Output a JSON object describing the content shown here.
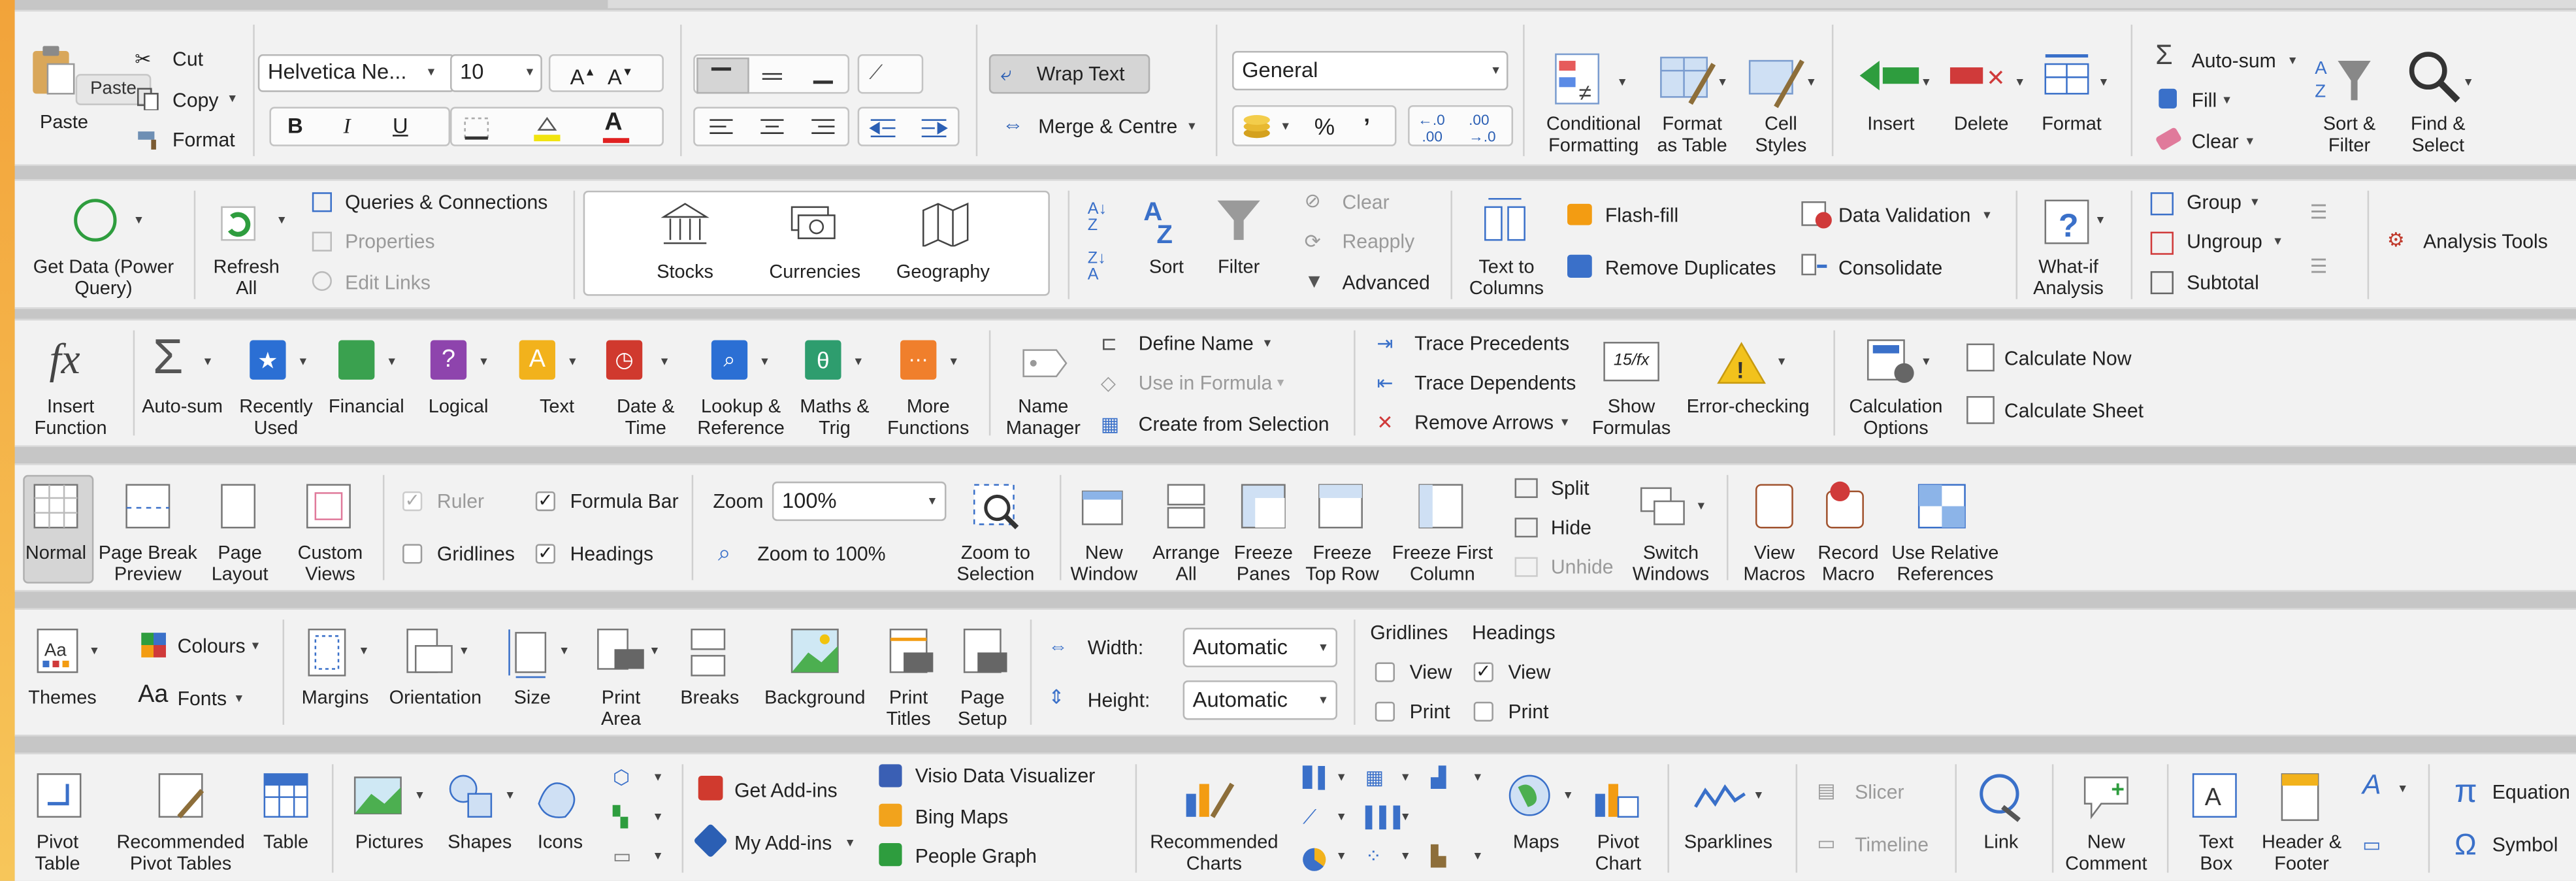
{
  "home": {
    "clipboard": {
      "paste": "Paste",
      "paste_tip": "Paste",
      "cut": "Cut",
      "copy": "Copy",
      "format": "Format"
    },
    "font": {
      "name": "Helvetica Ne...",
      "size": "10",
      "bold": "B",
      "italic": "I",
      "underline": "U",
      "fontcolor_letter": "A"
    },
    "alignment": {
      "wrap": "Wrap Text",
      "merge": "Merge & Centre"
    },
    "number": {
      "format": "General",
      "percent": "%",
      "comma": "’",
      "inc_dec": ".0\n.00",
      "dec_dec": ".00\n→.0"
    },
    "styles": {
      "conditional": "Conditional\nFormatting",
      "format_table": "Format\nas Table",
      "cell_styles": "Cell\nStyles"
    },
    "cells": {
      "insert": "Insert",
      "delete": "Delete",
      "format": "Format"
    },
    "editing": {
      "autosum": "Auto-sum",
      "fill": "Fill",
      "clear": "Clear",
      "sort_filter": "Sort &\nFilter",
      "find_select": "Find &\nSelect"
    }
  },
  "data": {
    "get_data": "Get Data (Power\nQuery)",
    "refresh": "Refresh\nAll",
    "queries": "Queries & Connections",
    "properties": "Properties",
    "edit_links": "Edit Links",
    "types": [
      "Stocks",
      "Currencies",
      "Geography"
    ],
    "sort": "Sort",
    "filter": "Filter",
    "clear": "Clear",
    "reapply": "Reapply",
    "advanced": "Advanced",
    "text_to_columns": "Text to\nColumns",
    "flash_fill": "Flash-fill",
    "remove_duplicates": "Remove Duplicates",
    "data_validation": "Data Validation",
    "consolidate": "Consolidate",
    "what_if": "What-if\nAnalysis",
    "group": "Group",
    "ungroup": "Ungroup",
    "subtotal": "Subtotal",
    "analysis_tools": "Analysis Tools"
  },
  "formulas": {
    "fx": "fx",
    "insert_function": "Insert\nFunction",
    "autosum": "Auto-sum",
    "recently_used": "Recently\nUsed",
    "financial": "Financial",
    "logical": "Logical",
    "text": "Text",
    "date_time": "Date &\nTime",
    "lookup": "Lookup &\nReference",
    "maths": "Maths &\nTrig",
    "more": "More\nFunctions",
    "name_manager": "Name\nManager",
    "define_name": "Define Name",
    "use_in_formula": "Use in Formula",
    "create_from_selection": "Create from Selection",
    "trace_precedents": "Trace Precedents",
    "trace_dependents": "Trace Dependents",
    "remove_arrows": "Remove Arrows",
    "show_formulas": "Show\nFormulas",
    "error_checking": "Error-checking",
    "calc_options": "Calculation\nOptions",
    "calc_now": "Calculate Now",
    "calc_sheet": "Calculate Sheet"
  },
  "view": {
    "normal": "Normal",
    "page_break": "Page Break\nPreview",
    "page_layout": "Page\nLayout",
    "custom_views": "Custom\nViews",
    "ruler": "Ruler",
    "formula_bar": "Formula Bar",
    "gridlines": "Gridlines",
    "headings": "Headings",
    "zoom_label": "Zoom",
    "zoom_value": "100%",
    "zoom_100": "Zoom to 100%",
    "zoom_selection": "Zoom to\nSelection",
    "new_window": "New\nWindow",
    "arrange": "Arrange\nAll",
    "freeze_panes": "Freeze\nPanes",
    "freeze_top": "Freeze\nTop Row",
    "freeze_first": "Freeze First\nColumn",
    "split": "Split",
    "hide": "Hide",
    "unhide": "Unhide",
    "switch_windows": "Switch\nWindows",
    "view_macros": "View\nMacros",
    "record_macro": "Record\nMacro",
    "relative_refs": "Use Relative\nReferences"
  },
  "page_layout": {
    "themes": "Themes",
    "colours": "Colours",
    "fonts": "Fonts",
    "margins": "Margins",
    "orientation": "Orientation",
    "size": "Size",
    "print_area": "Print\nArea",
    "breaks": "Breaks",
    "background": "Background",
    "print_titles": "Print\nTitles",
    "page_setup": "Page\nSetup",
    "width_label": "Width:",
    "width_value": "Automatic",
    "height_label": "Height:",
    "height_value": "Automatic",
    "gridlines_head": "Gridlines",
    "headings_head": "Headings",
    "view": "View",
    "print": "Print"
  },
  "insert": {
    "pivot_table": "Pivot\nTable",
    "recommended_pivot": "Recommended\nPivot Tables",
    "table": "Table",
    "pictures": "Pictures",
    "shapes": "Shapes",
    "icons": "Icons",
    "get_addins": "Get Add-ins",
    "my_addins": "My Add-ins",
    "visio": "Visio Data Visualizer",
    "bing_maps": "Bing Maps",
    "people_graph": "People Graph",
    "recommended_charts": "Recommended\nCharts",
    "maps": "Maps",
    "pivot_chart": "Pivot\nChart",
    "sparklines": "Sparklines",
    "slicer": "Slicer",
    "timeline": "Timeline",
    "link": "Link",
    "new_comment": "New\nComment",
    "text_box": "Text\nBox",
    "header_footer": "Header &\nFooter",
    "equation": "Equation",
    "symbol": "Symbol"
  },
  "colors": {
    "accent_green": "#2e7d32",
    "red": "#d32f2f",
    "blue": "#1e64c8",
    "purple": "#8e44ad",
    "orange": "#f39c12",
    "yellow": "#f1c40f"
  }
}
